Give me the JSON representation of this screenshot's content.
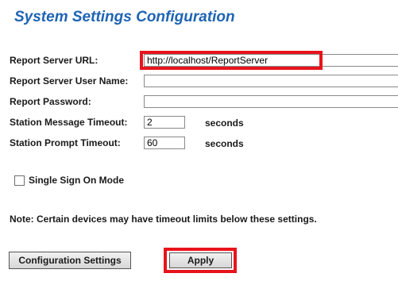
{
  "page": {
    "title": "System Settings Configuration"
  },
  "form": {
    "report_server_url": {
      "label": "Report Server URL:",
      "value": "http://localhost/ReportServer"
    },
    "report_server_user_name": {
      "label": "Report Server User Name:",
      "value": ""
    },
    "report_password": {
      "label": "Report Password:",
      "value": ""
    },
    "station_message_timeout": {
      "label": "Station Message Timeout:",
      "value": "2",
      "unit": "seconds"
    },
    "station_prompt_timeout": {
      "label": "Station Prompt Timeout:",
      "value": "60",
      "unit": "seconds"
    },
    "single_sign_on": {
      "label": "Single Sign On Mode",
      "checked": false
    }
  },
  "note": "Note: Certain devices may have timeout limits below these settings.",
  "buttons": {
    "configuration_settings": "Configuration Settings",
    "apply": "Apply"
  },
  "colors": {
    "title": "#1e64b4",
    "highlight": "#e8141c"
  }
}
